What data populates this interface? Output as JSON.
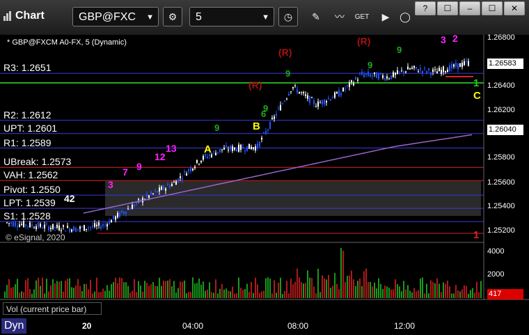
{
  "toolbar": {
    "title": "Chart",
    "symbol": "GBP@FXC",
    "interval": "5",
    "window_buttons": [
      "?",
      "☐",
      "–",
      "☐",
      "✕"
    ]
  },
  "chart": {
    "info": "* GBP@FXCM A0-FX, 5 (Dynamic)",
    "copyright": "© eSignal, 2020",
    "price_axis": [
      "1.26800",
      "1.26600",
      "1.26400",
      "1.26200",
      "1.26000",
      "1.25800",
      "1.25600",
      "1.25400",
      "1.25200"
    ],
    "last_price": "1.26583",
    "sma_price": "1.26040",
    "pivots": [
      {
        "label": "R3: 1.2651",
        "value": 1.2651,
        "color": "#3a3adc"
      },
      {
        "label": "R2: 1.2612",
        "value": 1.2612,
        "color": "#3a3adc"
      },
      {
        "label": "UPT: 1.2601",
        "value": 1.2601,
        "color": "#3a3adc"
      },
      {
        "label": "R1: 1.2589",
        "value": 1.2589,
        "color": "#3a3adc"
      },
      {
        "label": "UBreak: 1.2573",
        "value": 1.2573,
        "color": "#d22"
      },
      {
        "label": "VAH: 1.2562",
        "value": 1.2562,
        "color": "#d22"
      },
      {
        "label": "Pivot: 1.2550",
        "value": 1.255,
        "color": "#3a3adc"
      },
      {
        "label": "LPT: 1.2539",
        "value": 1.2539,
        "color": "#3a3adc"
      },
      {
        "label": "S1: 1.2528",
        "value": 1.2528,
        "color": "#3a3adc"
      }
    ],
    "annotations": {
      "r_marks": [
        "(R)",
        "(R)",
        "(R)"
      ],
      "a_mark": "A",
      "b_mark": "B",
      "c_mark": "C",
      "one_mark": "1",
      "nums": [
        "13",
        "12",
        "9",
        "7",
        "3",
        "3",
        "2",
        "9",
        "9",
        "9",
        "9",
        "9",
        "6",
        "42"
      ]
    },
    "colors": {
      "up": "#ffffff",
      "down": "#2255ff",
      "sma": "#9966cc",
      "green_line": "#22aa22"
    }
  },
  "volume": {
    "label": "Vol (current price bar)",
    "axis": [
      "4000",
      "2000"
    ],
    "last": "417"
  },
  "time_axis": [
    "20",
    "04:00",
    "08:00",
    "12:00"
  ],
  "footer": {
    "mode": "Dyn"
  }
}
